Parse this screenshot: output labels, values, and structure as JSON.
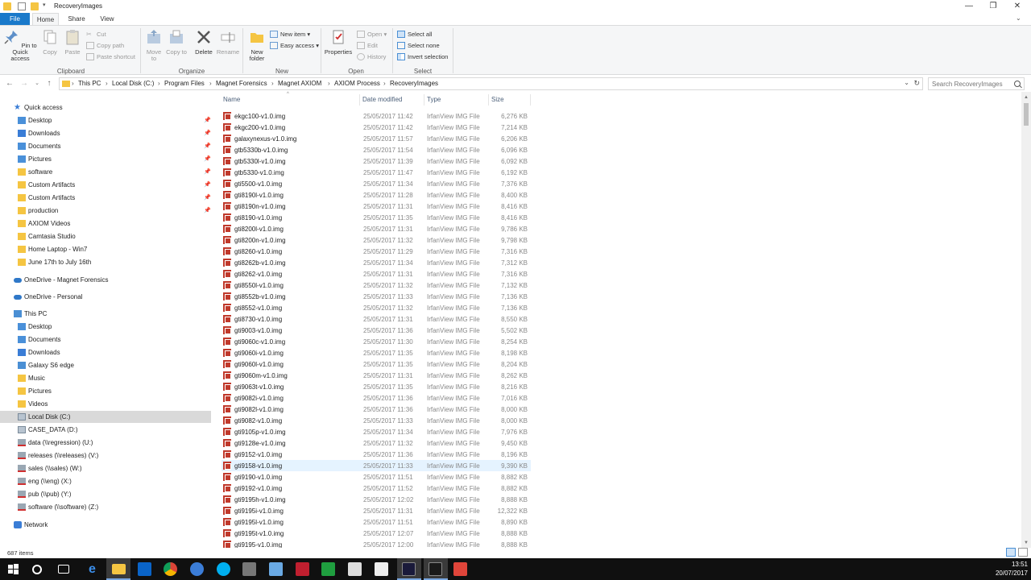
{
  "titlebar": {
    "title": "RecoveryImages",
    "minimize": "—",
    "maximize": "❐",
    "close": "✕"
  },
  "ribbon_tabs": [
    "File",
    "Home",
    "Share",
    "View"
  ],
  "ribbon": {
    "clipboard": {
      "label": "Clipboard",
      "pin": "Pin to Quick access",
      "copy": "Copy",
      "paste": "Paste",
      "cut": "Cut",
      "copy_path": "Copy path",
      "paste_shortcut": "Paste shortcut"
    },
    "organize": {
      "label": "Organize",
      "move_to": "Move to",
      "copy_to": "Copy to",
      "delete": "Delete",
      "rename": "Rename"
    },
    "new": {
      "label": "New",
      "new_folder": "New folder",
      "new_item": "New item",
      "easy_access": "Easy access"
    },
    "open": {
      "label": "Open",
      "properties": "Properties",
      "open": "Open",
      "edit": "Edit",
      "history": "History"
    },
    "select": {
      "label": "Select",
      "select_all": "Select all",
      "select_none": "Select none",
      "invert_selection": "Invert selection"
    }
  },
  "address": {
    "crumbs": [
      "This PC",
      "Local Disk (C:)",
      "Program Files",
      "Magnet Forensics",
      "Magnet AXIOM",
      "AXIOM Process",
      "RecoveryImages"
    ],
    "search_placeholder": "Search RecoveryImages"
  },
  "nav": {
    "quick_access": "Quick access",
    "quick_items": [
      "Desktop",
      "Downloads",
      "Documents",
      "Pictures",
      "software",
      "Custom Artifacts",
      "Custom Artifacts",
      "production",
      "AXIOM Videos",
      "Camtasia Studio",
      "Home Laptop - Win7",
      "June 17th to July 16th"
    ],
    "onedrive_business": "OneDrive - Magnet Forensics",
    "onedrive_personal": "OneDrive - Personal",
    "this_pc": "This PC",
    "pc_items": [
      "Desktop",
      "Documents",
      "Downloads",
      "Galaxy S6 edge",
      "Music",
      "Pictures",
      "Videos",
      "Local Disk (C:)",
      "CASE_DATA (D:)",
      "data (\\\\regression) (U:)",
      "releases (\\\\releases) (V:)",
      "sales (\\\\sales) (W:)",
      "eng (\\\\eng) (X:)",
      "pub (\\\\pub) (Y:)",
      "software (\\\\software) (Z:)"
    ],
    "network": "Network"
  },
  "columns": {
    "name": "Name",
    "date": "Date modified",
    "type": "Type",
    "size": "Size"
  },
  "files": [
    {
      "name": "ekgc100-v1.0.img",
      "date": "25/05/2017 11:42",
      "type": "IrfanView IMG File",
      "size": "6,276 KB"
    },
    {
      "name": "ekgc200-v1.0.img",
      "date": "25/05/2017 11:42",
      "type": "IrfanView IMG File",
      "size": "7,214 KB"
    },
    {
      "name": "galaxynexus-v1.0.img",
      "date": "25/05/2017 11:57",
      "type": "IrfanView IMG File",
      "size": "6,206 KB"
    },
    {
      "name": "gtb5330b-v1.0.img",
      "date": "25/05/2017 11:54",
      "type": "IrfanView IMG File",
      "size": "6,096 KB"
    },
    {
      "name": "gtb5330l-v1.0.img",
      "date": "25/05/2017 11:39",
      "type": "IrfanView IMG File",
      "size": "6,092 KB"
    },
    {
      "name": "gtb5330-v1.0.img",
      "date": "25/05/2017 11:47",
      "type": "IrfanView IMG File",
      "size": "6,192 KB"
    },
    {
      "name": "gti5500-v1.0.img",
      "date": "25/05/2017 11:34",
      "type": "IrfanView IMG File",
      "size": "7,376 KB"
    },
    {
      "name": "gti8190l-v1.0.img",
      "date": "25/05/2017 11:28",
      "type": "IrfanView IMG File",
      "size": "8,400 KB"
    },
    {
      "name": "gti8190n-v1.0.img",
      "date": "25/05/2017 11:31",
      "type": "IrfanView IMG File",
      "size": "8,416 KB"
    },
    {
      "name": "gti8190-v1.0.img",
      "date": "25/05/2017 11:35",
      "type": "IrfanView IMG File",
      "size": "8,416 KB"
    },
    {
      "name": "gti8200l-v1.0.img",
      "date": "25/05/2017 11:31",
      "type": "IrfanView IMG File",
      "size": "9,786 KB"
    },
    {
      "name": "gti8200n-v1.0.img",
      "date": "25/05/2017 11:32",
      "type": "IrfanView IMG File",
      "size": "9,798 KB"
    },
    {
      "name": "gti8260-v1.0.img",
      "date": "25/05/2017 11:29",
      "type": "IrfanView IMG File",
      "size": "7,316 KB"
    },
    {
      "name": "gti8262b-v1.0.img",
      "date": "25/05/2017 11:34",
      "type": "IrfanView IMG File",
      "size": "7,312 KB"
    },
    {
      "name": "gti8262-v1.0.img",
      "date": "25/05/2017 11:31",
      "type": "IrfanView IMG File",
      "size": "7,316 KB"
    },
    {
      "name": "gti8550l-v1.0.img",
      "date": "25/05/2017 11:32",
      "type": "IrfanView IMG File",
      "size": "7,132 KB"
    },
    {
      "name": "gti8552b-v1.0.img",
      "date": "25/05/2017 11:33",
      "type": "IrfanView IMG File",
      "size": "7,136 KB"
    },
    {
      "name": "gti8552-v1.0.img",
      "date": "25/05/2017 11:32",
      "type": "IrfanView IMG File",
      "size": "7,136 KB"
    },
    {
      "name": "gti8730-v1.0.img",
      "date": "25/05/2017 11:31",
      "type": "IrfanView IMG File",
      "size": "8,550 KB"
    },
    {
      "name": "gti9003-v1.0.img",
      "date": "25/05/2017 11:36",
      "type": "IrfanView IMG File",
      "size": "5,502 KB"
    },
    {
      "name": "gti9060c-v1.0.img",
      "date": "25/05/2017 11:30",
      "type": "IrfanView IMG File",
      "size": "8,254 KB"
    },
    {
      "name": "gti9060i-v1.0.img",
      "date": "25/05/2017 11:35",
      "type": "IrfanView IMG File",
      "size": "8,198 KB"
    },
    {
      "name": "gti9060l-v1.0.img",
      "date": "25/05/2017 11:35",
      "type": "IrfanView IMG File",
      "size": "8,204 KB"
    },
    {
      "name": "gti9060m-v1.0.img",
      "date": "25/05/2017 11:31",
      "type": "IrfanView IMG File",
      "size": "8,262 KB"
    },
    {
      "name": "gti9063t-v1.0.img",
      "date": "25/05/2017 11:35",
      "type": "IrfanView IMG File",
      "size": "8,216 KB"
    },
    {
      "name": "gti9082i-v1.0.img",
      "date": "25/05/2017 11:36",
      "type": "IrfanView IMG File",
      "size": "7,016 KB"
    },
    {
      "name": "gti9082l-v1.0.img",
      "date": "25/05/2017 11:36",
      "type": "IrfanView IMG File",
      "size": "8,000 KB"
    },
    {
      "name": "gti9082-v1.0.img",
      "date": "25/05/2017 11:33",
      "type": "IrfanView IMG File",
      "size": "8,000 KB"
    },
    {
      "name": "gti9105p-v1.0.img",
      "date": "25/05/2017 11:34",
      "type": "IrfanView IMG File",
      "size": "7,976 KB"
    },
    {
      "name": "gti9128e-v1.0.img",
      "date": "25/05/2017 11:32",
      "type": "IrfanView IMG File",
      "size": "9,450 KB"
    },
    {
      "name": "gti9152-v1.0.img",
      "date": "25/05/2017 11:36",
      "type": "IrfanView IMG File",
      "size": "8,196 KB"
    },
    {
      "name": "gti9158-v1.0.img",
      "date": "25/05/2017 11:33",
      "type": "IrfanView IMG File",
      "size": "9,390 KB"
    },
    {
      "name": "gti9190-v1.0.img",
      "date": "25/05/2017 11:51",
      "type": "IrfanView IMG File",
      "size": "8,882 KB"
    },
    {
      "name": "gti9192-v1.0.img",
      "date": "25/05/2017 11:52",
      "type": "IrfanView IMG File",
      "size": "8,882 KB"
    },
    {
      "name": "gti9195h-v1.0.img",
      "date": "25/05/2017 12:02",
      "type": "IrfanView IMG File",
      "size": "8,888 KB"
    },
    {
      "name": "gti9195i-v1.0.img",
      "date": "25/05/2017 11:31",
      "type": "IrfanView IMG File",
      "size": "12,322 KB"
    },
    {
      "name": "gti9195l-v1.0.img",
      "date": "25/05/2017 11:51",
      "type": "IrfanView IMG File",
      "size": "8,890 KB"
    },
    {
      "name": "gti9195t-v1.0.img",
      "date": "25/05/2017 12:07",
      "type": "IrfanView IMG File",
      "size": "8,888 KB"
    },
    {
      "name": "gti9195-v1.0.img",
      "date": "25/05/2017 12:00",
      "type": "IrfanView IMG File",
      "size": "8,888 KB"
    }
  ],
  "status": {
    "items": "687 items"
  },
  "clock": {
    "time": "13:51",
    "date": "20/07/2017"
  },
  "colors": {
    "accent": "#1979ca",
    "hover_row": "#e5f3ff",
    "taskbar": "#101010"
  }
}
